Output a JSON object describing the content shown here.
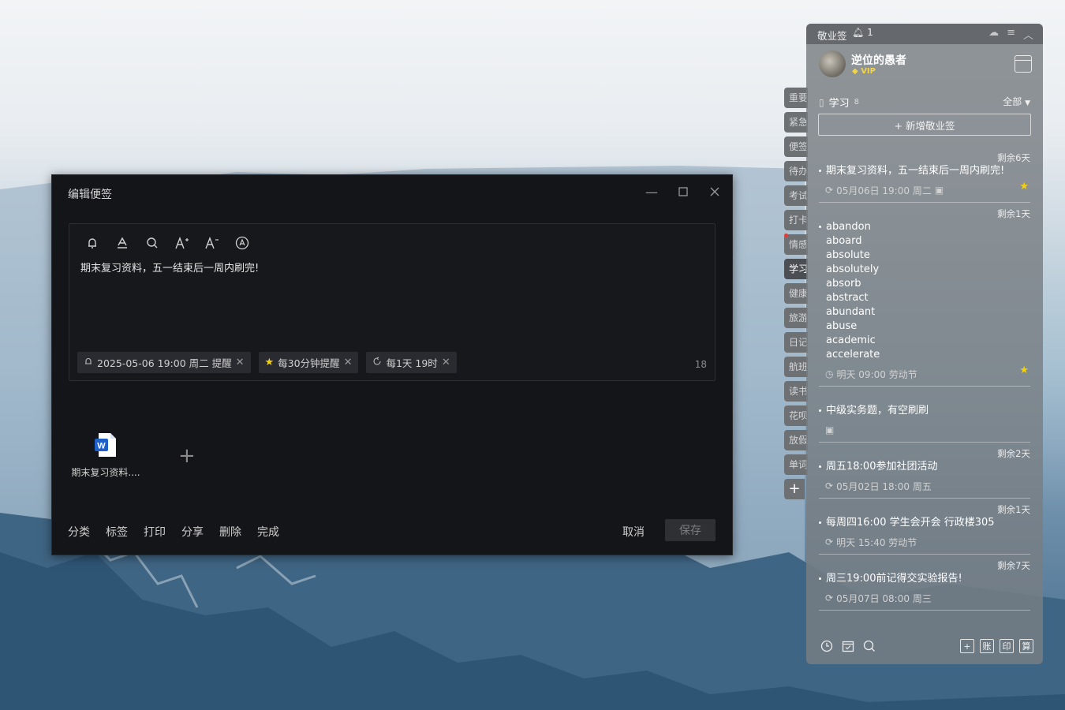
{
  "editor": {
    "title": "编辑便签",
    "content": "期末复习资料，五一结束后一周内刷完!",
    "char_count": "18",
    "tags": [
      {
        "label": "2025-05-06 19:00 周二 提醒",
        "icon": "bell-icon"
      },
      {
        "label": "每30分钟提醒",
        "icon": "star-icon"
      },
      {
        "label": "每1天 19时",
        "icon": "repeat-icon"
      }
    ],
    "attachment_name": "期末复习资料....",
    "footer": [
      "分类",
      "标签",
      "打印",
      "分享",
      "删除",
      "完成"
    ],
    "cancel": "取消",
    "save": "保存"
  },
  "categories": [
    "重要",
    "紧急",
    "便签",
    "待办",
    "考试",
    "打卡",
    "情感",
    "学习",
    "健康",
    "旅游",
    "日记",
    "航班",
    "读书",
    "花呗",
    "放假",
    "单词"
  ],
  "active_category": "学习",
  "panel": {
    "app_name": "敬业签",
    "notify_count": "1",
    "user_name": "逆位的愚者",
    "vip": "VIP",
    "category": "学习",
    "category_count": "8",
    "filter": "全部",
    "new_note": "+ 新增敬业签",
    "notes": [
      {
        "remain": "剩余6天",
        "title": "期末复习资料，五一结束后一周内刷完!",
        "meta": "05月06日 19:00 周二",
        "starred": true
      },
      {
        "remain": "剩余1天",
        "title": "abandon",
        "lines": [
          "aboard",
          "absolute",
          "absolutely",
          "absorb",
          "abstract",
          "abundant",
          "abuse",
          "academic",
          "accelerate"
        ],
        "meta": "明天 09:00 劳动节",
        "starred": true
      },
      {
        "remain": "",
        "title": "中级实务题，有空刷刷",
        "meta": "",
        "starred": false
      },
      {
        "remain": "剩余2天",
        "title": "周五18:00参加社团活动",
        "meta": "05月02日 18:00 周五",
        "starred": false
      },
      {
        "remain": "剩余1天",
        "title": "每周四16:00 学生会开会 行政楼305",
        "meta": "明天 15:40 劳动节",
        "starred": false
      },
      {
        "remain": "剩余7天",
        "title": "周三19:00前记得交实验报告!",
        "meta": "05月07日 08:00 周三",
        "starred": false
      }
    ],
    "bottom_buttons": [
      "账",
      "印",
      "算"
    ]
  },
  "colors": {
    "star": "#f5d10c",
    "editor_bg": "#141518",
    "panel_bg": "#787e82"
  }
}
